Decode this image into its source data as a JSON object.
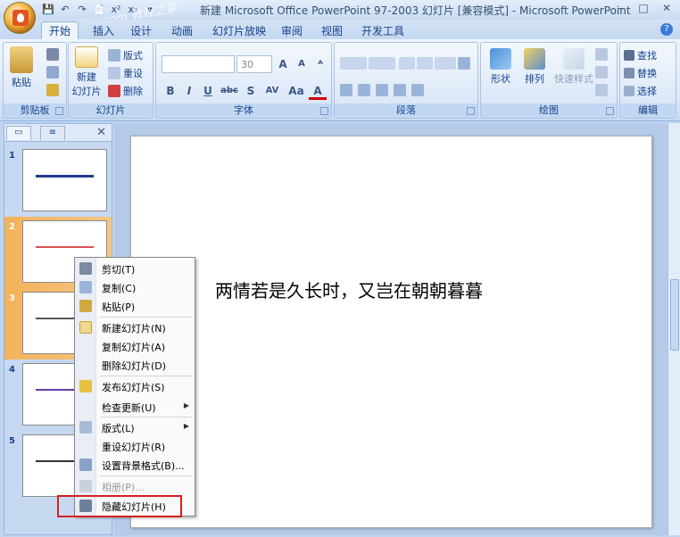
{
  "window": {
    "title": "新建 Microsoft Office PowerPoint 97-2003 幻灯片 [兼容模式] - Microsoft PowerPoint",
    "minimize": "–",
    "maximize": "□",
    "close": "✕"
  },
  "watermark": "Jiaochengzhijia.com 教程之家",
  "qat": {
    "save": "💾",
    "undo": "↶",
    "redo": "↷",
    "preview": "📄",
    "superscript": "x²",
    "subscript": "x₂",
    "more": "▾"
  },
  "tabs": [
    "开始",
    "插入",
    "设计",
    "动画",
    "幻灯片放映",
    "审阅",
    "视图",
    "开发工具"
  ],
  "ribbon": {
    "clipboard": {
      "paste": "粘贴",
      "group": "剪贴板"
    },
    "slides": {
      "new_slide": "新建",
      "new_slide2": "幻灯片",
      "layout": "版式",
      "reset": "重设",
      "delete": "删除",
      "group": "幻灯片"
    },
    "font": {
      "font_name": "",
      "font_size": "30",
      "grow": "A",
      "shrink": "A",
      "clear": "ᴬ",
      "bold": "B",
      "italic": "I",
      "underline": "U",
      "strike": "abc",
      "shadow": "S",
      "spacing": "AV",
      "case": "Aa",
      "color": "A",
      "group": "字体"
    },
    "paragraph": {
      "group": "段落"
    },
    "drawing": {
      "shape": "形状",
      "arrange": "排列",
      "quick_styles": "快速样式",
      "group": "绘图"
    },
    "editing": {
      "find": "查找",
      "replace": "替换",
      "select": "选择",
      "group": "编辑"
    }
  },
  "panel": {
    "slides": [
      {
        "num": "1",
        "color": "#1f3a8a"
      },
      {
        "num": "2",
        "color": "#e05050"
      },
      {
        "num": "3",
        "color": "#555555"
      },
      {
        "num": "4",
        "color": "#6a3ab0"
      },
      {
        "num": "5",
        "color": "#333333"
      }
    ]
  },
  "slide": {
    "text": "两情若是久长时，又岂在朝朝暮暮"
  },
  "context_menu": {
    "items": [
      {
        "label": "剪切(T)",
        "icon": "scissors-icon"
      },
      {
        "label": "复制(C)",
        "icon": "copy-icon"
      },
      {
        "label": "粘贴(P)",
        "icon": "paste-icon"
      },
      {
        "label": "新建幻灯片(N)",
        "icon": "new-slide-icon"
      },
      {
        "label": "复制幻灯片(A)",
        "icon": ""
      },
      {
        "label": "删除幻灯片(D)",
        "icon": ""
      },
      {
        "label": "发布幻灯片(S)",
        "icon": "publish-icon"
      },
      {
        "label": "检查更新(U)",
        "icon": ""
      },
      {
        "label": "版式(L)",
        "icon": "layout-icon"
      },
      {
        "label": "重设幻灯片(R)",
        "icon": ""
      },
      {
        "label": "设置背景格式(B)...",
        "icon": "background-icon"
      },
      {
        "label": "相册(P)...",
        "icon": "album-icon"
      },
      {
        "label": "隐藏幻灯片(H)",
        "icon": "hide-slide-icon"
      }
    ]
  }
}
